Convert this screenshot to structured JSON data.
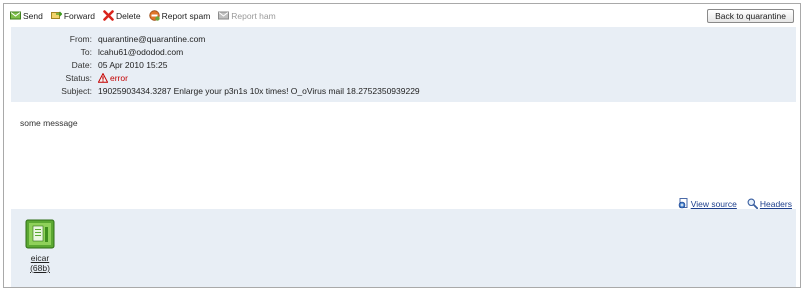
{
  "toolbar": {
    "send": "Send",
    "forward": "Forward",
    "delete": "Delete",
    "report_spam": "Report spam",
    "report_ham": "Report ham",
    "back": "Back to quarantine"
  },
  "headers": {
    "from_label": "From:",
    "from": "quarantine@quarantine.com",
    "to_label": "To:",
    "to": "lcahu61@ododod.com",
    "date_label": "Date:",
    "date": "05 Apr 2010 15:25",
    "status_label": "Status:",
    "status": "error",
    "subject_label": "Subject:",
    "subject": "19025903434.3287 Enlarge your p3n1s 10x times! O_oVirus mail 18.2752350939229"
  },
  "body": {
    "text": "some message"
  },
  "links": {
    "view_source": "View source",
    "headers": "Headers"
  },
  "attachments": [
    {
      "name": "eicar",
      "size": "(68b)"
    }
  ],
  "icons": {
    "send": "send-icon",
    "forward": "forward-icon",
    "delete": "delete-icon",
    "report_spam": "report-spam-icon",
    "report_ham": "report-ham-icon",
    "status": "error-icon",
    "view_source": "view-source-icon",
    "headers": "headers-icon",
    "attachment": "file-icon"
  },
  "colors": {
    "panel": "#e8eef5",
    "error": "#c40000",
    "link": "#1d3f8c"
  }
}
